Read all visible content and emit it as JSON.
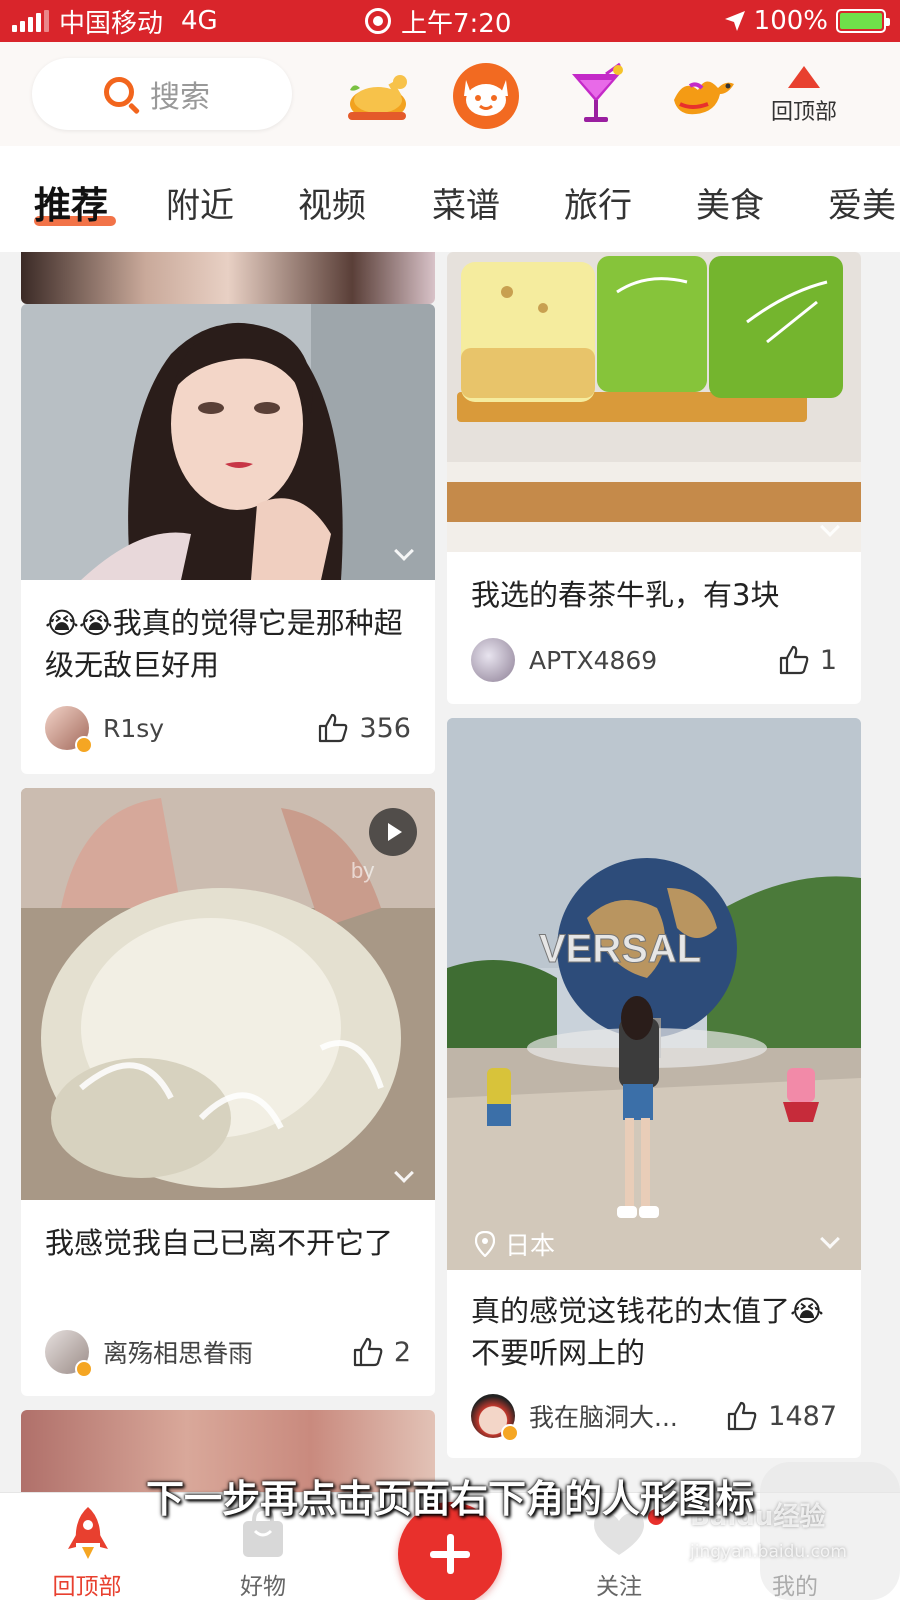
{
  "status_bar": {
    "carrier": "中国移动",
    "network": "4G",
    "time": "上午7:20",
    "battery": "100%",
    "battery_level": 1.0
  },
  "header": {
    "search_placeholder": "搜索",
    "icons": [
      "roast-chicken-icon",
      "cat-face-icon",
      "cocktail-icon",
      "camel-icon"
    ],
    "back_to_top_label": "回顶部"
  },
  "tabs": [
    "推荐",
    "附近",
    "视频",
    "菜谱",
    "旅行",
    "美食",
    "爱美"
  ],
  "active_tab": "推荐",
  "feed": {
    "cards": [
      {
        "title": "😭😭我真的觉得它是那种超级无敌巨好用",
        "author": "R1sy",
        "likes": "356",
        "image": "portrait-photo"
      },
      {
        "title": "我选的春茶牛乳，有3块",
        "author": "APTX4869",
        "likes": "1",
        "image": "matcha-cake-photo"
      },
      {
        "title": "我感觉我自己已离不开它了",
        "author": "离殇相思眷雨",
        "likes": "2",
        "image": "video-thumbnail",
        "overlay_text": "by"
      },
      {
        "title": "真的感觉这钱花的太值了😭不要听网上的",
        "author": "我在脑洞大...",
        "likes": "1487",
        "image": "universal-globe-photo",
        "location": "日本",
        "photo_text": "VERSAL"
      }
    ]
  },
  "bottom_nav": {
    "items": [
      "回顶部",
      "好物",
      "关注",
      "我的"
    ],
    "active": "回顶部"
  },
  "subtitle": "下一步再点击页面右下角的人形图标",
  "watermark": {
    "brand": "Baidu经验",
    "url": "jingyan.baidu.com"
  },
  "colors": {
    "status_bar": "#d9252b",
    "accent": "#f05a28",
    "plus_button": "#e8302c"
  }
}
